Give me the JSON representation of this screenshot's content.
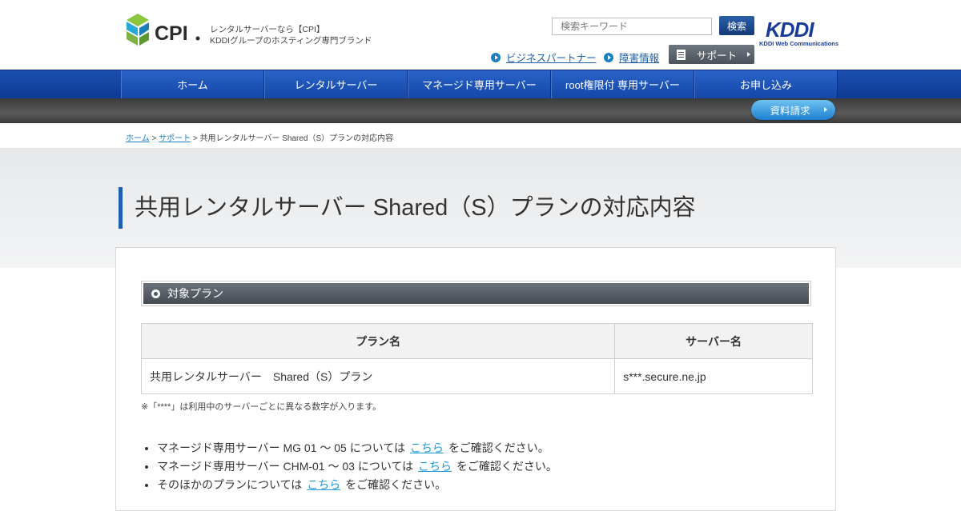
{
  "header": {
    "tagline_line1": "レンタルサーバーなら【CPI】",
    "tagline_line2": "KDDIグループのホスティング専門ブランド",
    "search_placeholder": "検索キーワード",
    "search_button": "検索",
    "links": [
      "ビジネスパートナー",
      "障害情報"
    ],
    "support_button": "サポート"
  },
  "nav": {
    "items": [
      "ホーム",
      "レンタルサーバー",
      "マネージド専用サーバー",
      "root権限付 専用サーバー",
      "お申し込み"
    ],
    "doc_request": "資料請求"
  },
  "breadcrumb": {
    "home": "ホーム",
    "support": "サポート",
    "separator": ">",
    "current": "共用レンタルサーバー Shared（S）プランの対応内容"
  },
  "page": {
    "title": "共用レンタルサーバー Shared（S）プランの対応内容"
  },
  "section": {
    "heading": "対象プラン",
    "table": {
      "headers": [
        "プラン名",
        "サーバー名"
      ],
      "rows": [
        [
          "共用レンタルサーバー　Shared（S）プラン",
          "s***.secure.ne.jp"
        ]
      ]
    },
    "note": "※「****」は利用中のサーバーごとに異なる数字が入ります。",
    "list": [
      {
        "before": "マネージド専用サーバー MG 01 ～ 05 については",
        "link": "こちら",
        "after": "をご確認ください。"
      },
      {
        "before": "マネージド専用サーバー CHM-01 ～ 03 については",
        "link": "こちら",
        "after": "をご確認ください。"
      },
      {
        "before": "そのほかのプランについては",
        "link": "こちら",
        "after": "をご確認ください。"
      }
    ]
  },
  "colors": {
    "brand_blue": "#1c4fb0",
    "link_blue": "#1d7fc3"
  }
}
